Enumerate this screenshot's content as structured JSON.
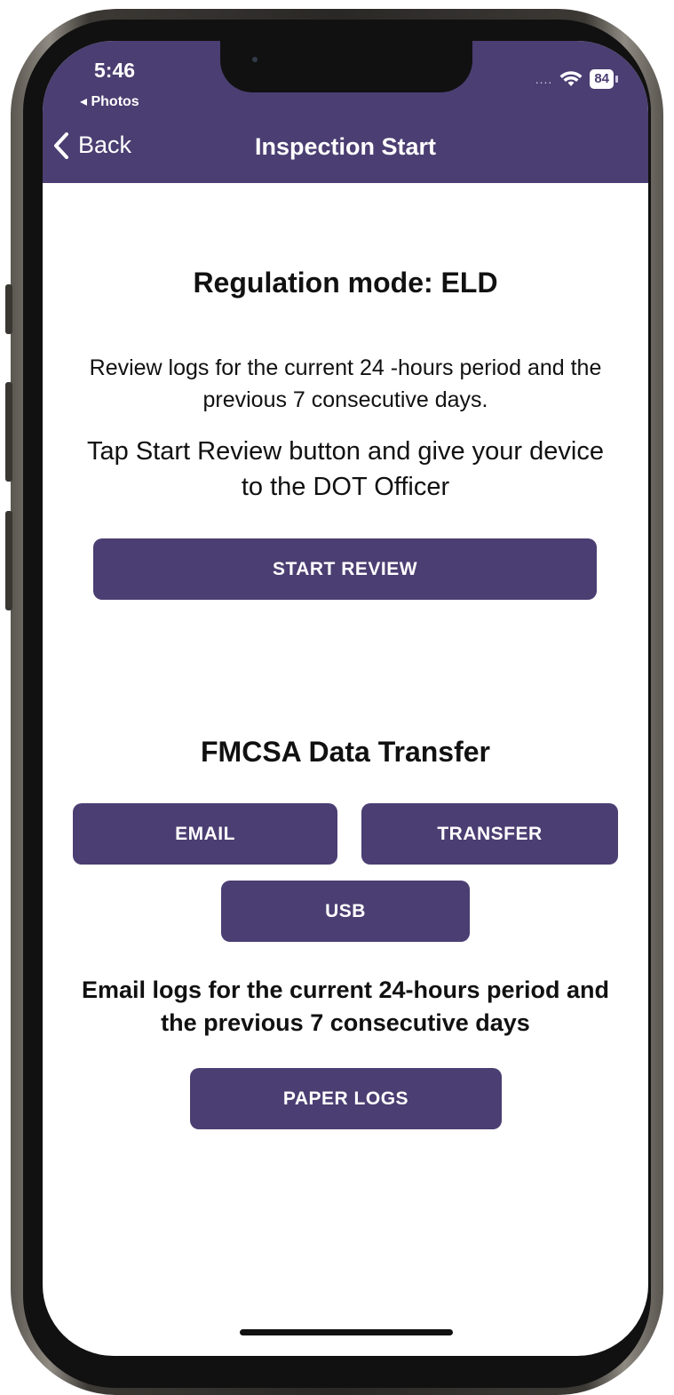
{
  "status_bar": {
    "time": "5:46",
    "back_app": "◂ Photos",
    "signal": "....",
    "battery": "84"
  },
  "nav": {
    "back_label": "Back",
    "title": "Inspection Start"
  },
  "regulation": {
    "heading": "Regulation mode: ELD",
    "review_text": "Review logs for the current 24 -hours period and the previous 7 consecutive days.",
    "instruction_text": "Tap Start Review button and give your device to the DOT Officer",
    "start_review_label": "START REVIEW"
  },
  "transfer": {
    "heading": "FMCSA Data Transfer",
    "email_label": "EMAIL",
    "transfer_label": "TRANSFER",
    "usb_label": "USB",
    "email_text": "Email logs for the current 24-hours period and the previous 7 consecutive days",
    "paper_logs_label": "PAPER LOGS"
  },
  "colors": {
    "brand": "#4b3e72",
    "background": "#ffffff",
    "text": "#111111"
  },
  "icons": {
    "back": "chevron-left-icon",
    "wifi": "wifi-icon",
    "battery": "battery-icon"
  }
}
